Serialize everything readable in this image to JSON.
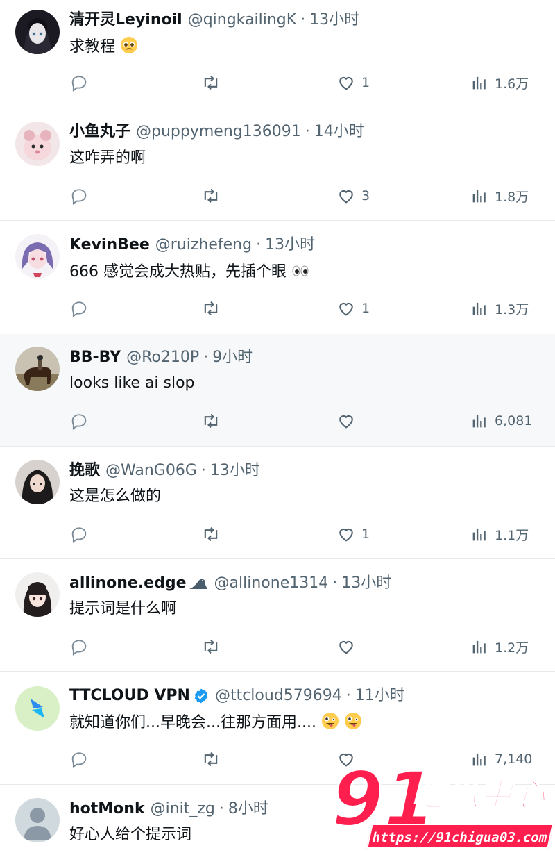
{
  "posts": [
    {
      "display_name": "清开灵Leyinoil",
      "handle": "@qingkailingK",
      "time": "13小时",
      "text": "求教程",
      "text_emoji": "pleading-face",
      "reply_count": "",
      "retweet_count": "",
      "like_count": "1",
      "views": "1.6万",
      "avatar": "dark-anime-girl"
    },
    {
      "display_name": "小鱼丸子",
      "handle": "@puppymeng136091",
      "time": "14小时",
      "text": "这咋弄的啊",
      "reply_count": "",
      "retweet_count": "",
      "like_count": "3",
      "views": "1.8万",
      "avatar": "pink-plush"
    },
    {
      "display_name": "KevinBee",
      "handle": "@ruizhefeng",
      "time": "13小时",
      "text": "666 感觉会成大热贴，先插个眼",
      "text_emoji": "eyes",
      "reply_count": "",
      "retweet_count": "",
      "like_count": "1",
      "views": "1.3万",
      "avatar": "purple-hair-anime"
    },
    {
      "display_name": "BB-BY",
      "handle": "@Ro210P",
      "time": "9小时",
      "text": "looks like ai slop",
      "reply_count": "",
      "retweet_count": "",
      "like_count": "",
      "views": "6,081",
      "avatar": "horse-rider"
    },
    {
      "display_name": "挽歌",
      "handle": "@WanG06G",
      "time": "13小时",
      "text": "这是怎么做的",
      "reply_count": "",
      "retweet_count": "",
      "like_count": "1",
      "views": "1.1万",
      "avatar": "dark-hair-woman"
    },
    {
      "display_name": "allinone.edge",
      "name_emoji": "seal",
      "handle": "@allinone1314",
      "time": "13小时",
      "text": "提示词是什么啊",
      "reply_count": "",
      "retweet_count": "",
      "like_count": "",
      "views": "1.2万",
      "avatar": "anime-girl-bangs"
    },
    {
      "display_name": "TTCLOUD VPN",
      "verified": true,
      "handle": "@ttcloud579694",
      "time": "11小时",
      "text": "就知道你们...早晚会...往那方面用....",
      "text_emoji": "zany-face",
      "reply_count": "",
      "retweet_count": "",
      "like_count": "",
      "views": "7,140",
      "avatar": "blue-logo"
    },
    {
      "display_name": "hotMonk",
      "handle": "@init_zg",
      "time": "8小时",
      "text": "好心人给个提示词",
      "avatar": "default-person"
    }
  ],
  "colors": {
    "text_primary": "#0f1419",
    "text_secondary": "#536471",
    "divider": "#e7ebee",
    "hover_bg": "#f7f8f9",
    "verified": "#1d9bf0",
    "watermark": "#ff1f4e"
  },
  "icons": {
    "reply": "reply-icon",
    "retweet": "retweet-icon",
    "like": "heart-icon",
    "views": "views-chart-icon"
  },
  "watermark": {
    "number": "91",
    "name": "吃瓜中心",
    "url": "https://91chigua03.com"
  }
}
